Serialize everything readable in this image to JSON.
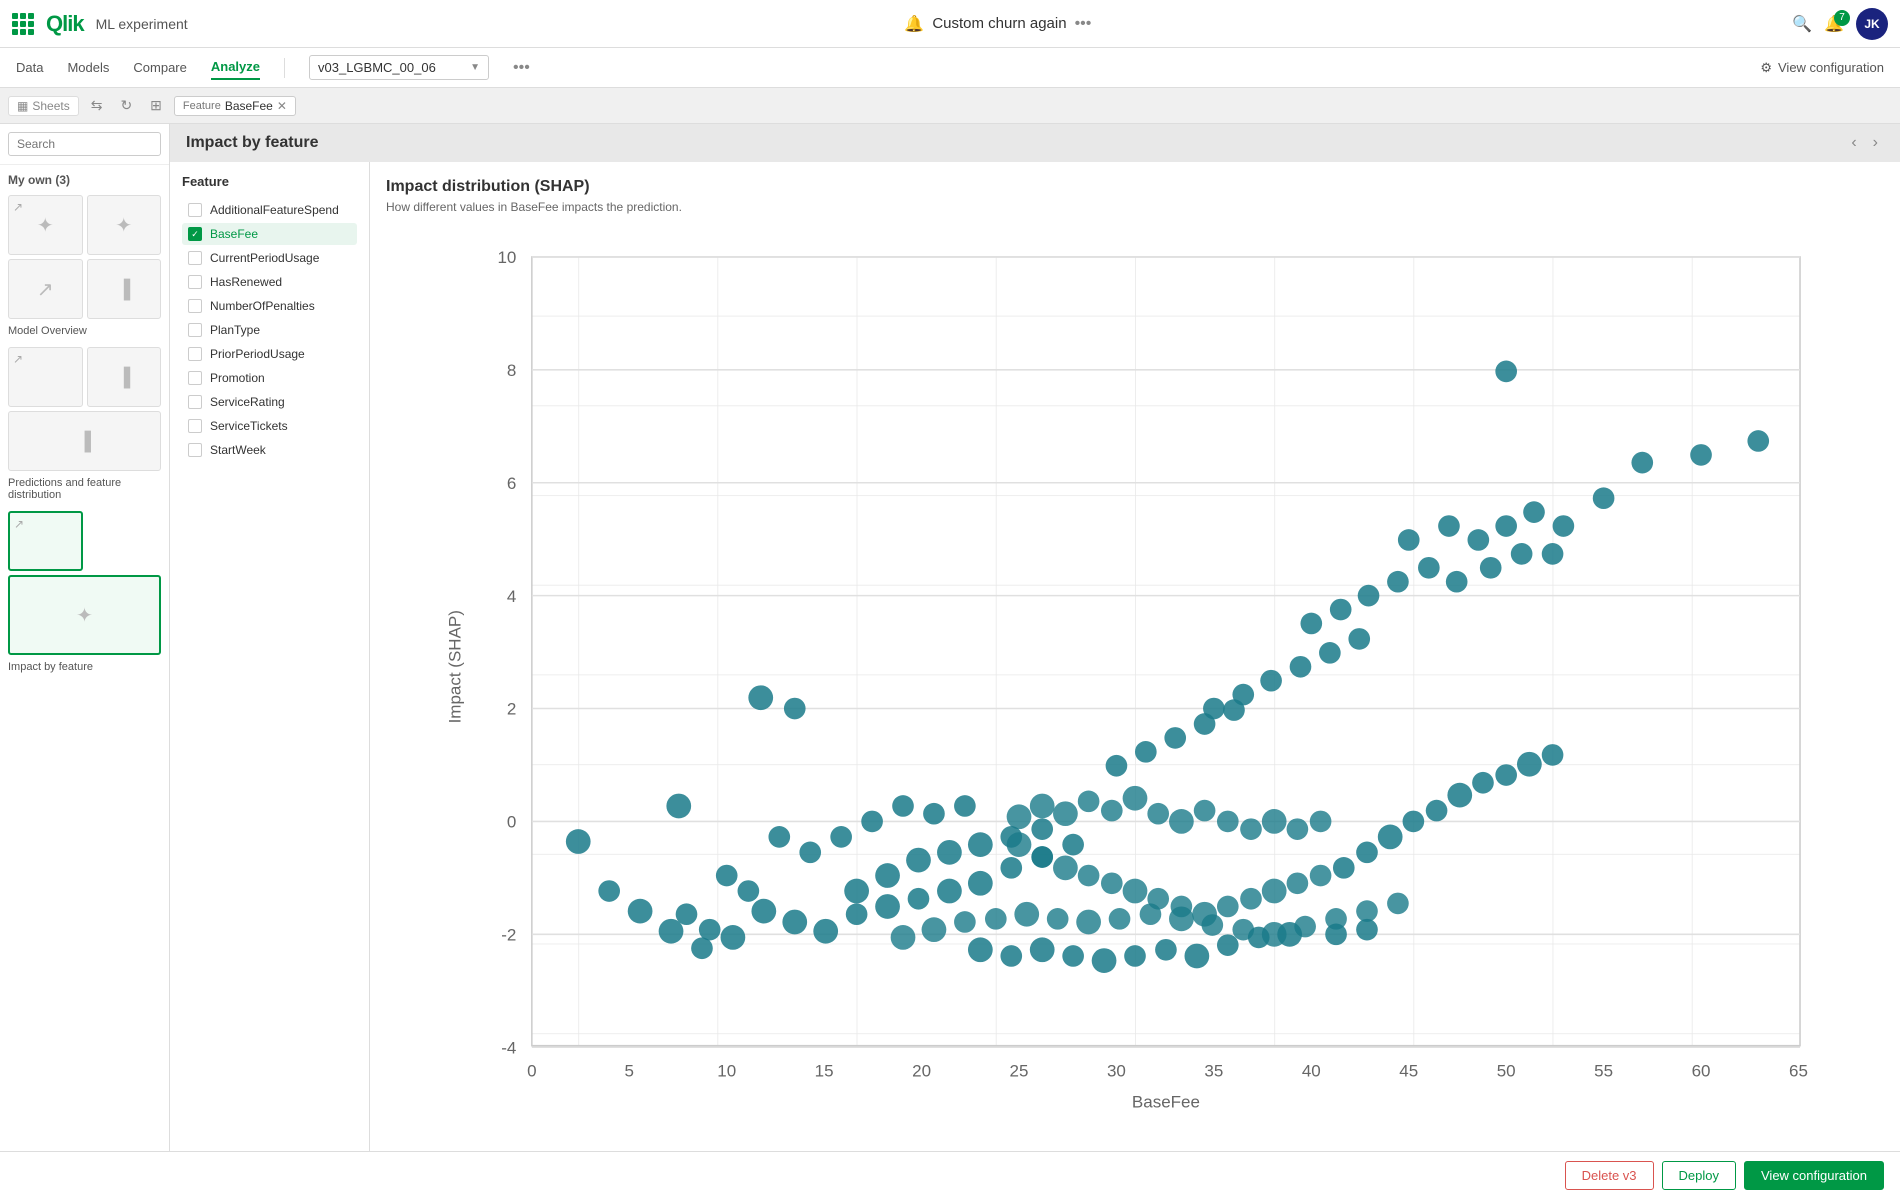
{
  "topbar": {
    "app_name": "ML experiment",
    "experiment_title": "Custom churn again",
    "notification_count": "7",
    "avatar_initials": "JK"
  },
  "navbar": {
    "items": [
      "Data",
      "Models",
      "Compare",
      "Analyze"
    ],
    "active_item": "Analyze",
    "model_selector": "v03_LGBMC_00_06",
    "view_config_label": "View configuration"
  },
  "chips": [
    {
      "label": "Feature",
      "value": "BaseFee"
    }
  ],
  "sidebar": {
    "section_label": "My own (3)",
    "sheets": [
      {
        "id": "model-overview",
        "label": "Model Overview"
      },
      {
        "id": "predictions-feature",
        "label": "Predictions and feature distribution"
      },
      {
        "id": "impact-by-feature",
        "label": "Impact by feature",
        "active": true
      }
    ]
  },
  "content": {
    "header_title": "Impact by feature",
    "feature_panel_title": "Feature",
    "features": [
      {
        "id": "AdditionalFeatureSpend",
        "label": "AdditionalFeatureSpend",
        "checked": false
      },
      {
        "id": "BaseFee",
        "label": "BaseFee",
        "checked": true
      },
      {
        "id": "CurrentPeriodUsage",
        "label": "CurrentPeriodUsage",
        "checked": false
      },
      {
        "id": "HasRenewed",
        "label": "HasRenewed",
        "checked": false
      },
      {
        "id": "NumberOfPenalties",
        "label": "NumberOfPenalties",
        "checked": false
      },
      {
        "id": "PlanType",
        "label": "PlanType",
        "checked": false
      },
      {
        "id": "PriorPeriodUsage",
        "label": "PriorPeriodUsage",
        "checked": false
      },
      {
        "id": "Promotion",
        "label": "Promotion",
        "checked": false
      },
      {
        "id": "ServiceRating",
        "label": "ServiceRating",
        "checked": false
      },
      {
        "id": "ServiceTickets",
        "label": "ServiceTickets",
        "checked": false
      },
      {
        "id": "StartWeek",
        "label": "StartWeek",
        "checked": false
      }
    ],
    "chart_title": "Impact distribution (SHAP)",
    "chart_subtitle": "How different values in BaseFee impacts the prediction.",
    "x_axis_label": "BaseFee",
    "y_axis_label": "Impact (SHAP)"
  },
  "bottom_bar": {
    "delete_label": "Delete v3",
    "deploy_label": "Deploy",
    "view_config_label": "View configuration"
  }
}
